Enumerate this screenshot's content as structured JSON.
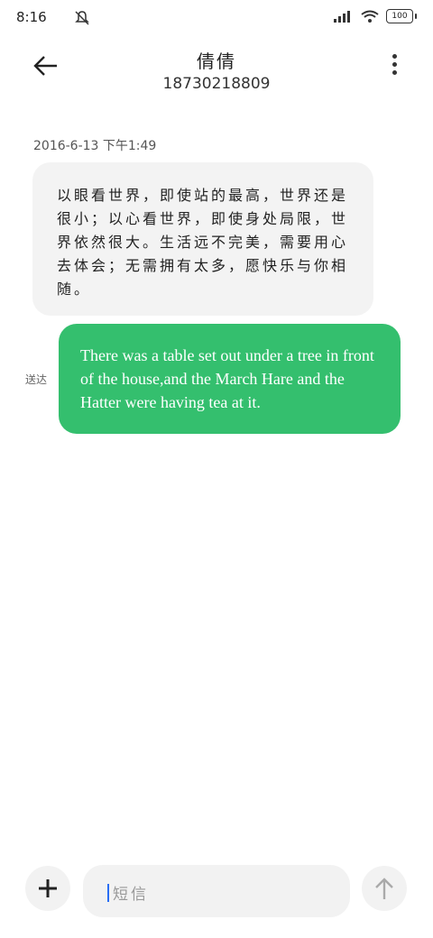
{
  "status_bar": {
    "time": "8:16",
    "battery": "100",
    "icons": [
      "mute-icon",
      "signal-icon",
      "wifi-icon",
      "battery-icon"
    ]
  },
  "header": {
    "contact_name": "倩倩",
    "contact_number": "18730218809",
    "icons": [
      "back-arrow-icon",
      "more-vert-icon"
    ]
  },
  "conversation": {
    "timestamp": "2016-6-13 下午1:49",
    "incoming_message": "以眼看世界，即使站的最高，世界还是很小；以心看世界，即使身处局限，世界依然很大。生活远不完美，需要用心去体会；无需拥有太多，愿快乐与你相随。",
    "sender_label": "送达",
    "outgoing_message": "There was a table set out under a tree in front of the house,and the March Hare and the Hatter were having tea at it."
  },
  "composer": {
    "placeholder": "短信",
    "icons": [
      "plus-icon",
      "send-arrow-icon"
    ]
  },
  "colors": {
    "outgoing_bubble": "#34bf6e",
    "incoming_bubble": "#f3f3f3",
    "cursor": "#2a6ef5"
  }
}
